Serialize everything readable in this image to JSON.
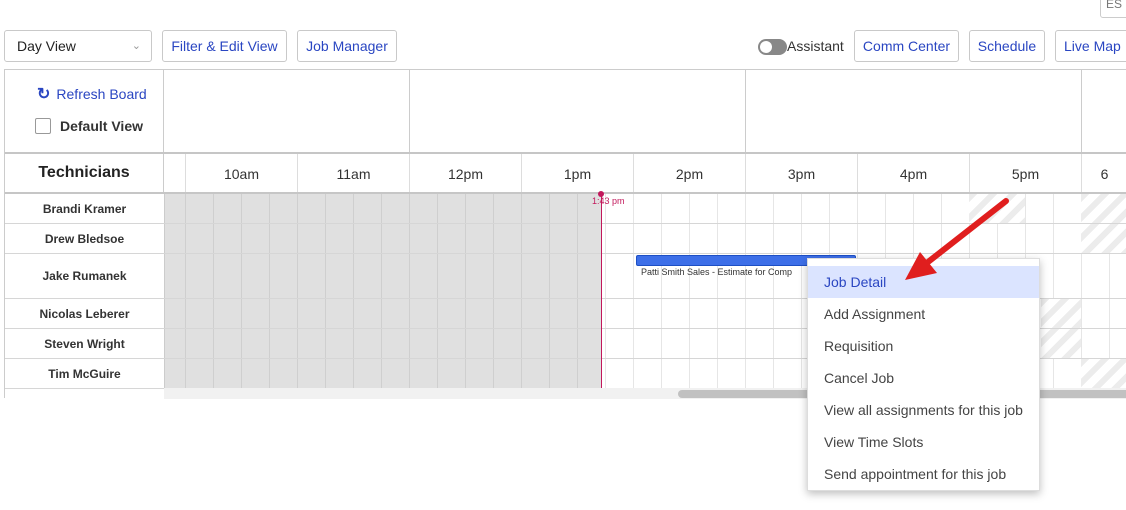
{
  "corner": {
    "text": "ES"
  },
  "toolbar": {
    "view_select": "Day View",
    "filter_edit_view": "Filter & Edit View",
    "job_manager": "Job Manager",
    "assistant_label": "Assistant",
    "assistant_on": false,
    "comm_center": "Comm Center",
    "schedule": "Schedule",
    "live_map": "Live Map"
  },
  "board": {
    "refresh": "Refresh Board",
    "default_view": "Default View",
    "technicians_header": "Technicians",
    "times": [
      "10am",
      "11am",
      "12pm",
      "1pm",
      "2pm",
      "3pm",
      "4pm",
      "5pm",
      "6"
    ],
    "technicians": [
      "Brandi Kramer",
      "Drew Bledsoe",
      "Jake Rumanek",
      "Nicolas Leberer",
      "Steven Wright",
      "Tim McGuire"
    ],
    "current_time_label": "1:43 pm",
    "job": {
      "text": "Patti Smith Sales - Estimate for Comp"
    }
  },
  "context_menu": {
    "items": [
      "Job Detail",
      "Add Assignment",
      "Requisition",
      "Cancel Job",
      "View all assignments for this job",
      "View Time Slots",
      "Send appointment for this job"
    ],
    "highlighted": "Job Detail"
  },
  "colors": {
    "accent": "#2a46c2",
    "now_line": "#c2185b",
    "job_bar": "#3d6fe8",
    "arrow": "#e01e1e",
    "highlight": "#dbe4ff"
  }
}
